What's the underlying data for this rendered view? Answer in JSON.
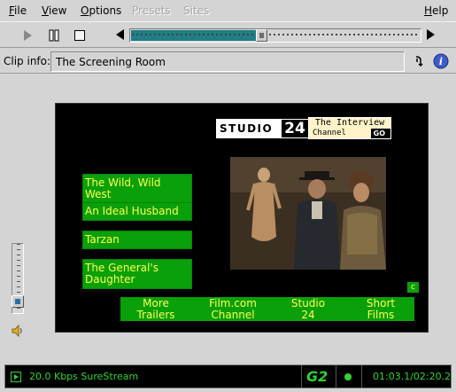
{
  "menu": {
    "file": "File",
    "view": "View",
    "options": "Options",
    "presets": "Presets",
    "sites": "Sites",
    "help": "Help"
  },
  "transport": {
    "play_icon": "play-icon",
    "pause_icon": "pause-icon",
    "stop_icon": "stop-icon",
    "seek_position": 0.45
  },
  "clip": {
    "label": "Clip info:",
    "value": "The Screening Room"
  },
  "video": {
    "logo": {
      "studio": "STUDIO",
      "number": "24",
      "line1": "The Interview",
      "line2": "Channel",
      "go": "GO"
    },
    "side_buttons": [
      "The Wild, Wild West",
      "An Ideal Husband",
      "Tarzan",
      "The General's Daughter"
    ],
    "bottom_buttons": [
      {
        "line1": "More",
        "line2": "Trailers"
      },
      {
        "line1": "Film.com",
        "line2": "Channel"
      },
      {
        "line1": "Studio",
        "line2": "24"
      },
      {
        "line1": "Short",
        "line2": "Films"
      }
    ],
    "corner_label": "c"
  },
  "volume": {
    "level": 0.1
  },
  "status": {
    "stream": "20.0 Kbps SureStream",
    "logo": "G2",
    "time": "01:03.1/02:20.2"
  },
  "colors": {
    "seek_fill": "#1f7e86",
    "green_button": "#0aa00a",
    "green_text": "#ffff4a",
    "status_green": "#2fd62f"
  }
}
